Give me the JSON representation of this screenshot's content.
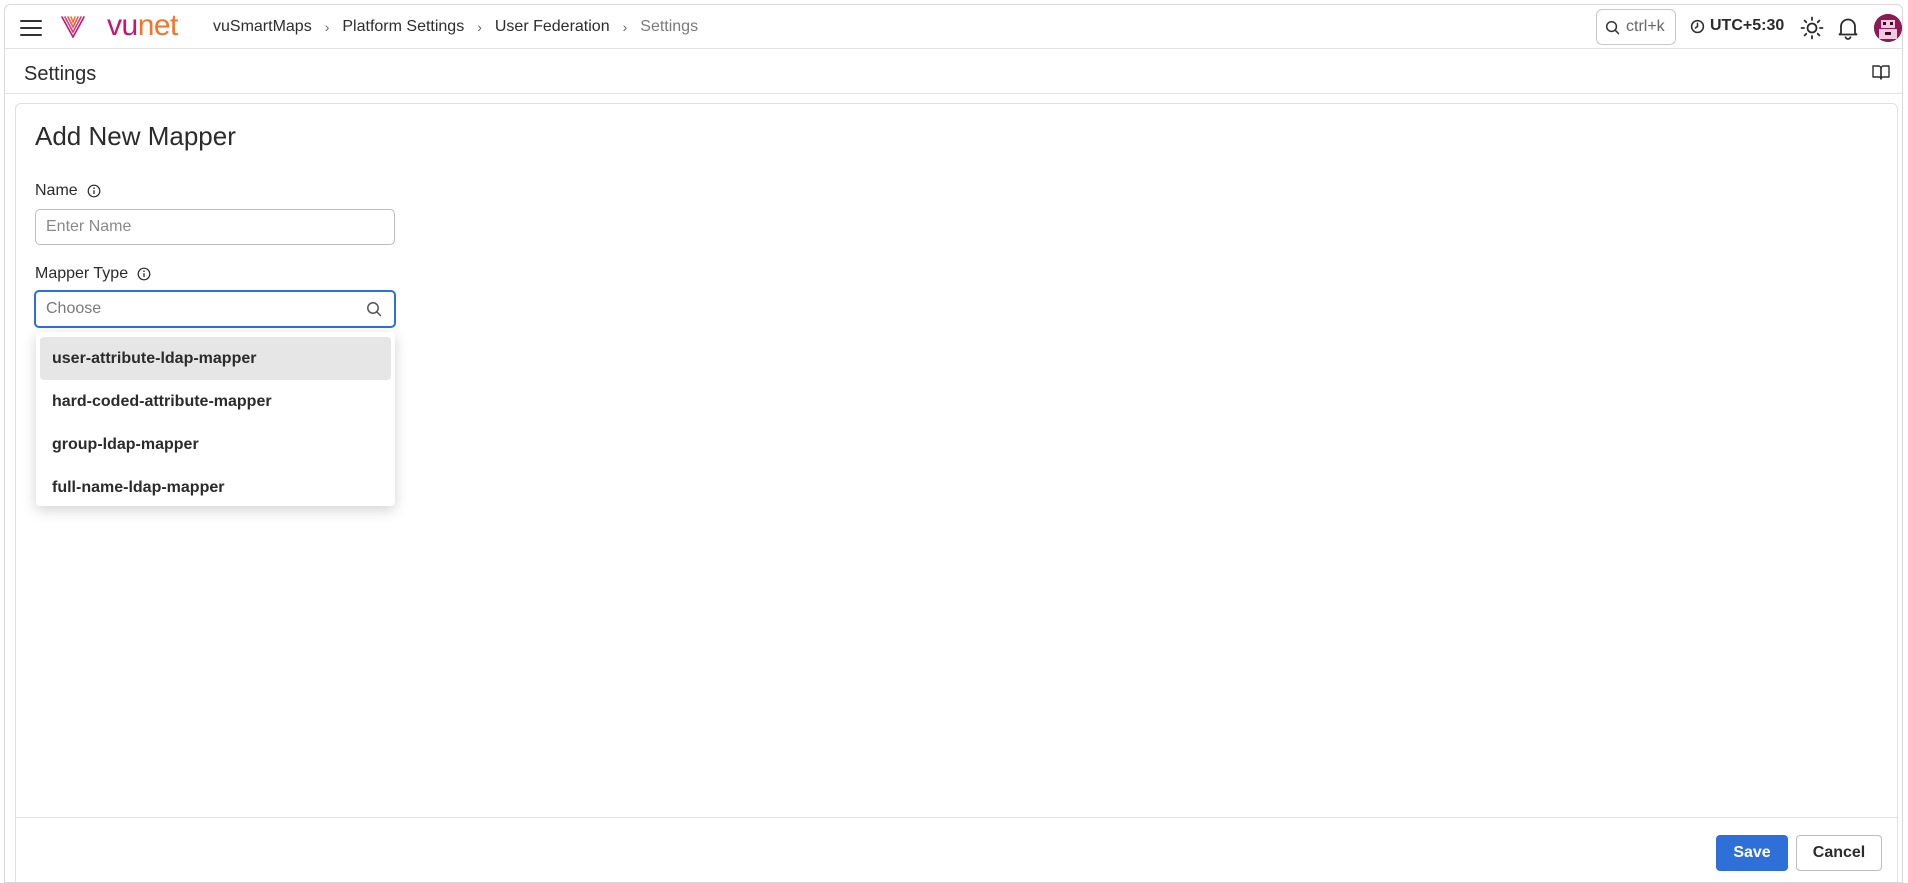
{
  "brand": {
    "logo_vu": "vu",
    "logo_net": "net",
    "primary_color": "#c4166b",
    "secondary_color": "#f0762d"
  },
  "topbar": {
    "menu_icon": "hamburger-icon",
    "breadcrumb": [
      "vuSmartMaps",
      "Platform Settings",
      "User Federation",
      "Settings"
    ],
    "search_shortcut": "ctrl+k",
    "timezone": "UTC+5:30",
    "theme_icon": "sun-icon",
    "notification_icon": "bell-icon"
  },
  "subheader": {
    "title": "Settings",
    "docs_icon": "book-icon"
  },
  "form": {
    "title": "Add New Mapper",
    "name_label": "Name",
    "name_placeholder": "Enter Name",
    "name_value": "",
    "mapper_type_label": "Mapper Type",
    "mapper_type_placeholder": "Choose",
    "mapper_type_options": [
      "user-attribute-ldap-mapper",
      "hard-coded-attribute-mapper",
      "group-ldap-mapper",
      "full-name-ldap-mapper"
    ],
    "highlighted_option_index": 0
  },
  "actions": {
    "save_label": "Save",
    "cancel_label": "Cancel",
    "accent_color": "#2f6fd8"
  }
}
